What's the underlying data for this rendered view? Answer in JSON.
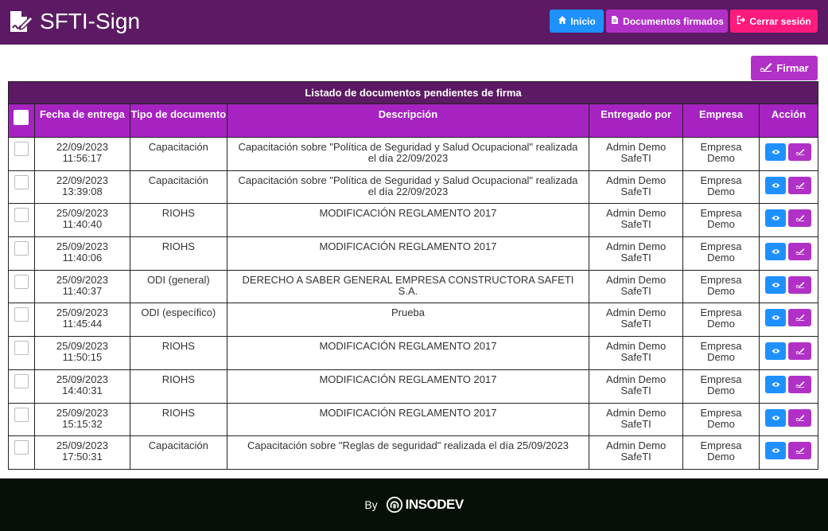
{
  "app": {
    "title": "SFTI-Sign"
  },
  "nav": {
    "inicio": "Inicio",
    "documentos_firmados": "Documentos firmados",
    "cerrar_sesion": "Cerrar sesión"
  },
  "actions": {
    "firmar": "Firmar"
  },
  "table": {
    "title": "Listado de documentos pendientes de firma",
    "headers": {
      "fecha": "Fecha de entrega",
      "tipo": "Tipo de documento",
      "descripcion": "Descripción",
      "entregado": "Entregado por",
      "empresa": "Empresa",
      "accion": "Acción"
    },
    "rows": [
      {
        "date": "22/09/2023",
        "time": "11:56:17",
        "type": "Capacitación",
        "desc": "Capacitación sobre \"Política de Seguridad y Salud Ocupacional\" realizada el día 22/09/2023",
        "by1": "Admin Demo",
        "by2": "SafeTI",
        "co1": "Empresa",
        "co2": "Demo"
      },
      {
        "date": "22/09/2023",
        "time": "13:39:08",
        "type": "Capacitación",
        "desc": "Capacitación sobre \"Política de Seguridad y Salud Ocupacional\" realizada el día 22/09/2023",
        "by1": "Admin Demo",
        "by2": "SafeTI",
        "co1": "Empresa",
        "co2": "Demo"
      },
      {
        "date": "25/09/2023",
        "time": "11:40:40",
        "type": "RIOHS",
        "desc": "MODIFICACIÓN REGLAMENTO 2017",
        "by1": "Admin Demo",
        "by2": "SafeTI",
        "co1": "Empresa",
        "co2": "Demo"
      },
      {
        "date": "25/09/2023",
        "time": "11:40:06",
        "type": "RIOHS",
        "desc": "MODIFICACIÓN REGLAMENTO 2017",
        "by1": "Admin Demo",
        "by2": "SafeTI",
        "co1": "Empresa",
        "co2": "Demo"
      },
      {
        "date": "25/09/2023",
        "time": "11:40:37",
        "type": "ODI (general)",
        "desc": "DERECHO A SABER GENERAL EMPRESA CONSTRUCTORA SAFETI S.A.",
        "by1": "Admin Demo",
        "by2": "SafeTI",
        "co1": "Empresa",
        "co2": "Demo"
      },
      {
        "date": "25/09/2023",
        "time": "11:45:44",
        "type": "ODI (específico)",
        "desc": "Prueba",
        "by1": "Admin Demo",
        "by2": "SafeTI",
        "co1": "Empresa",
        "co2": "Demo"
      },
      {
        "date": "25/09/2023",
        "time": "11:50:15",
        "type": "RIOHS",
        "desc": "MODIFICACIÓN REGLAMENTO 2017",
        "by1": "Admin Demo",
        "by2": "SafeTI",
        "co1": "Empresa",
        "co2": "Demo"
      },
      {
        "date": "25/09/2023",
        "time": "14:40:31",
        "type": "RIOHS",
        "desc": "MODIFICACIÓN REGLAMENTO 2017",
        "by1": "Admin Demo",
        "by2": "SafeTI",
        "co1": "Empresa",
        "co2": "Demo"
      },
      {
        "date": "25/09/2023",
        "time": "15:15:32",
        "type": "RIOHS",
        "desc": "MODIFICACIÓN REGLAMENTO 2017",
        "by1": "Admin Demo",
        "by2": "SafeTI",
        "co1": "Empresa",
        "co2": "Demo"
      },
      {
        "date": "25/09/2023",
        "time": "17:50:31",
        "type": "Capacitación",
        "desc": "Capacitación sobre \"Reglas de seguridad\" realizada el día 25/09/2023",
        "by1": "Admin Demo",
        "by2": "SafeTI",
        "co1": "Empresa",
        "co2": "Demo"
      }
    ]
  },
  "footer": {
    "by": "By",
    "brand": "INSODEV"
  },
  "icons": {
    "brand": "file-signature-icon",
    "inicio": "home-icon",
    "documentos": "file-icon",
    "logout": "sign-out-icon",
    "firmar": "signature-icon",
    "view": "eye-icon",
    "sign": "signature-icon"
  },
  "colors": {
    "navbar": "#5b1a63",
    "table_title": "#5b1a63",
    "table_header": "#a623c2",
    "blue": "#1e90ff",
    "purple": "#b131c7",
    "pink": "#ff1b7d",
    "footer": "#061006"
  }
}
